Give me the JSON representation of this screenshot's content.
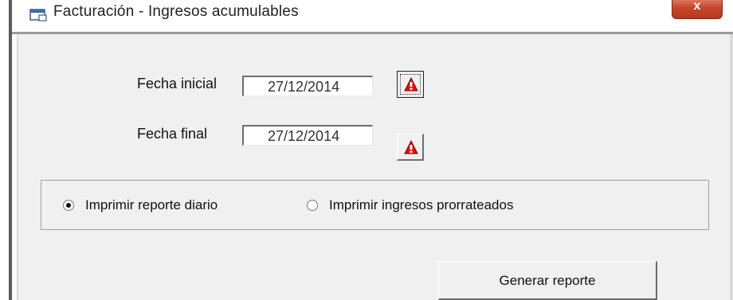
{
  "window": {
    "title": "Facturación - Ingresos acumulables",
    "close_label": "x"
  },
  "form": {
    "start_date": {
      "label": "Fecha inicial",
      "value": "27/12/2014"
    },
    "end_date": {
      "label": "Fecha final",
      "value": "27/12/2014"
    }
  },
  "options": {
    "daily_report": {
      "label": "Imprimir reporte diario",
      "selected": true
    },
    "prorated_income": {
      "label": "Imprimir ingresos prorrateados",
      "selected": false
    }
  },
  "actions": {
    "generate_label": "Generar reporte"
  },
  "colors": {
    "calendar_icon": "#e01010",
    "close_button": "#c9452c"
  }
}
